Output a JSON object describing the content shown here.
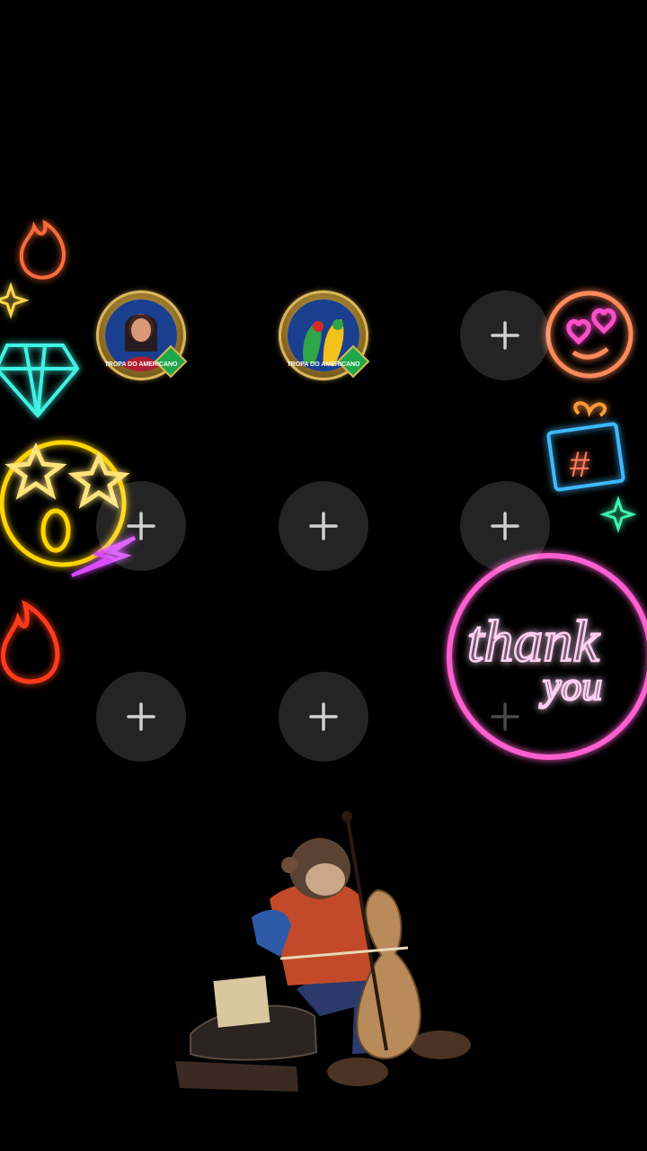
{
  "seats": {
    "row1": [
      {
        "type": "avatar",
        "badge_text": "TROPA DO AMERICANO"
      },
      {
        "type": "avatar",
        "badge_text": "TROPA DO AMERICANO"
      },
      {
        "type": "empty"
      }
    ],
    "row2": [
      {
        "type": "empty"
      },
      {
        "type": "empty"
      },
      {
        "type": "empty"
      }
    ],
    "row3": [
      {
        "type": "empty"
      },
      {
        "type": "empty"
      },
      {
        "type": "empty"
      }
    ]
  },
  "decor": {
    "thank_you_line1": "thank",
    "thank_you_line2": "you",
    "hashtag": "#",
    "icons": [
      "fire-icon",
      "sparkle-icon",
      "diamond-icon",
      "star-eyes-emoji-icon",
      "lightning-icon",
      "heart-eyes-emoji-icon",
      "gift-icon",
      "thank-you-neon-sign",
      "monkey-cellist-illustration"
    ]
  },
  "colors": {
    "background": "#000000",
    "slot_fill": "rgba(255,255,255,0.14)",
    "plus": "#d0d0d0",
    "neon_pink": "#ff4fc8",
    "neon_yellow": "#ffd400",
    "neon_cyan": "#3ff2e2",
    "neon_orange": "#ff7a2e"
  }
}
